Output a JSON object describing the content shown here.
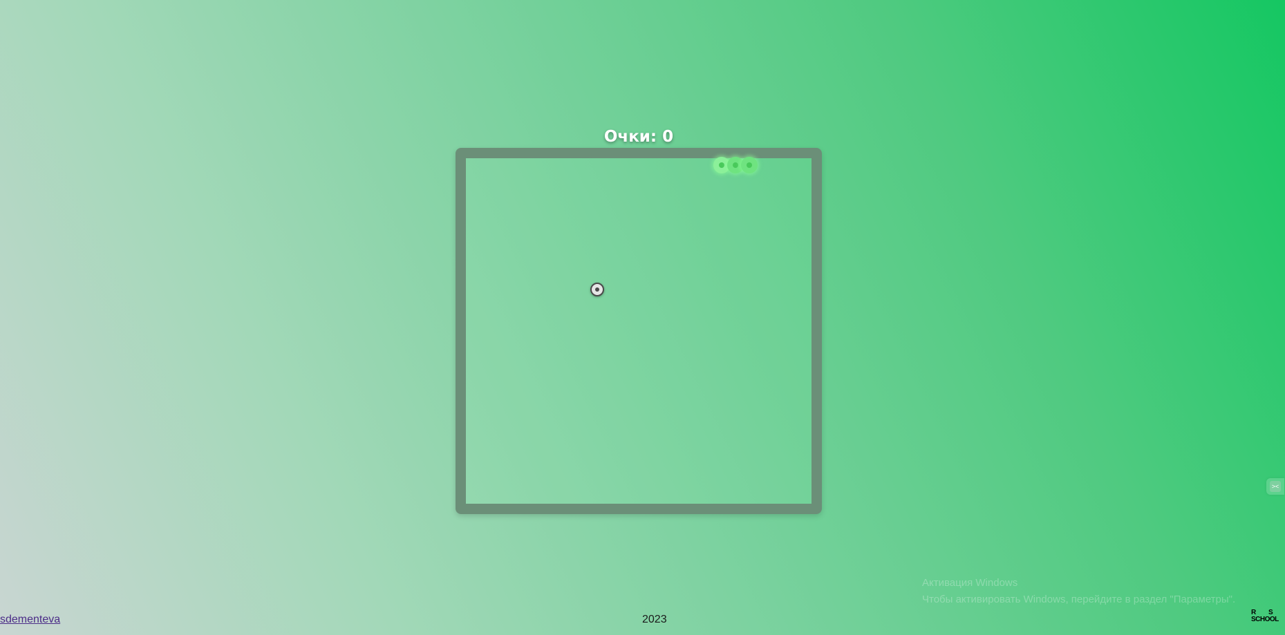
{
  "game": {
    "score_label": "Очки: 0",
    "score": 0,
    "grid_size": 25,
    "snake": [
      {
        "col": 18,
        "row": 0,
        "part": "head"
      },
      {
        "col": 19,
        "row": 0,
        "part": "body"
      },
      {
        "col": 20,
        "row": 0,
        "part": "body"
      }
    ],
    "food": {
      "col": 9,
      "row": 9
    }
  },
  "footer": {
    "author_link": "sdementeva",
    "year": "2023"
  },
  "overlay": {
    "activation_line1": "Активация Windows",
    "activation_line2": "Чтобы активировать Windows, перейдите в раздел \"Параметры\"."
  },
  "logo": {
    "r": "R",
    "s": "S",
    "school": "SCHOOL"
  },
  "colors": {
    "board_border": "#6b8f78",
    "snake": "#6fe380",
    "food": "#e6e6e6",
    "score_text": "#ffffff"
  },
  "icons": {
    "side_tab": "code-icon",
    "food": "target-icon"
  }
}
